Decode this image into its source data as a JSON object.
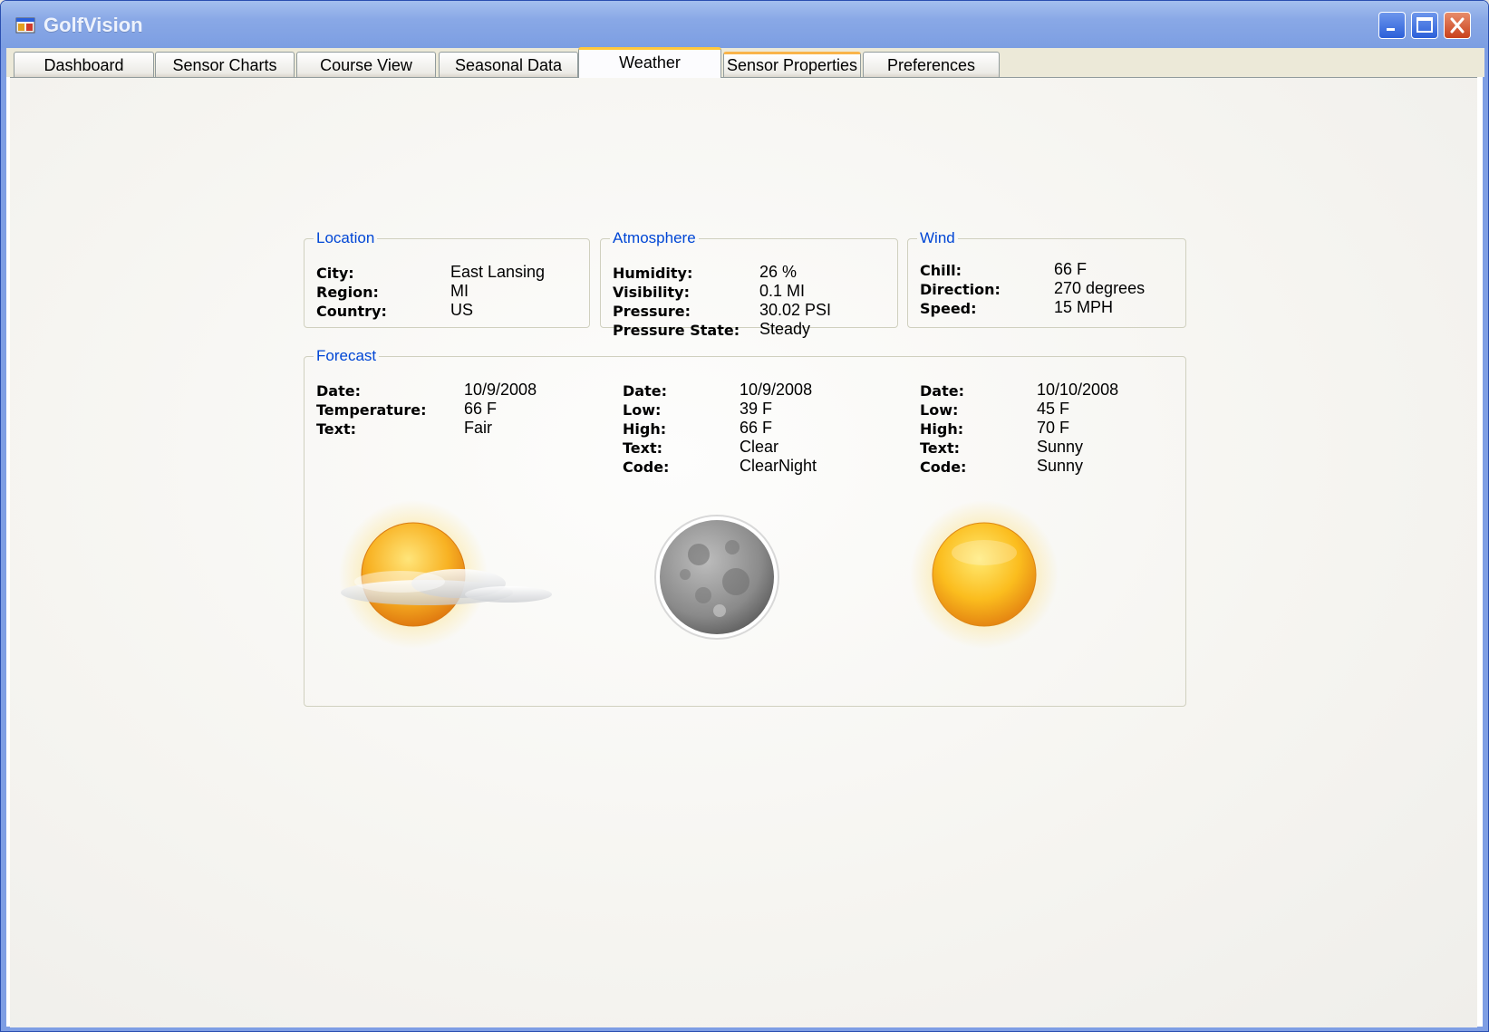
{
  "window": {
    "title": "GolfVision"
  },
  "tabs": [
    "Dashboard",
    "Sensor Charts",
    "Course View",
    "Seasonal Data",
    "Weather",
    "Sensor Properties",
    "Preferences"
  ],
  "active_tab": "Weather",
  "location": {
    "legend": "Location",
    "city_label": "City:",
    "city": "East Lansing",
    "region_label": "Region:",
    "region": "MI",
    "country_label": "Country:",
    "country": "US"
  },
  "atmosphere": {
    "legend": "Atmosphere",
    "humidity_label": "Humidity:",
    "humidity": "26 %",
    "visibility_label": "Visibility:",
    "visibility": "0.1 MI",
    "pressure_label": "Pressure:",
    "pressure": "30.02 PSI",
    "pressure_state_label": "Pressure State:",
    "pressure_state": "Steady"
  },
  "wind": {
    "legend": "Wind",
    "chill_label": "Chill:",
    "chill": "66 F",
    "direction_label": "Direction:",
    "direction": "270 degrees",
    "speed_label": "Speed:",
    "speed": "15 MPH"
  },
  "forecast": {
    "legend": "Forecast",
    "current": {
      "date_label": "Date:",
      "date": "10/9/2008",
      "temperature_label": "Temperature:",
      "temperature": "66 F",
      "text_label": "Text:",
      "text": "Fair",
      "icon": "sun-cloud-icon"
    },
    "day1": {
      "date_label": "Date:",
      "date": "10/9/2008",
      "low_label": "Low:",
      "low": "39 F",
      "high_label": "High:",
      "high": "66 F",
      "text_label": "Text:",
      "text": "Clear",
      "code_label": "Code:",
      "code": "ClearNight",
      "icon": "moon-icon"
    },
    "day2": {
      "date_label": "Date:",
      "date": "10/10/2008",
      "low_label": "Low:",
      "low": "45 F",
      "high_label": "High:",
      "high": "70 F",
      "text_label": "Text:",
      "text": "Sunny",
      "code_label": "Code:",
      "code": "Sunny",
      "icon": "sun-icon"
    }
  },
  "colors": {
    "title_bar": "#7c9ee2",
    "legend_text": "#0046d5",
    "active_tab_accent": "#ffc83c",
    "close_button": "#c8401c"
  }
}
